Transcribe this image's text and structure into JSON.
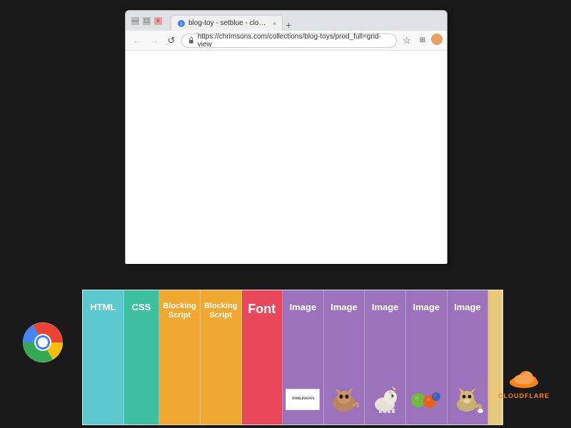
{
  "browser": {
    "tab": {
      "favicon": "ℹ",
      "title": "blog-toy - setblue - cloud...",
      "close": "×"
    },
    "new_tab_label": "+",
    "toolbar": {
      "back": "←",
      "forward": "→",
      "reload": "↺",
      "home": "⌂",
      "address": "https://chrimsons.com/collections/blog-toys/prod_full=grid-view",
      "bookmark": "☆",
      "extensions": "⊞",
      "account": "●"
    },
    "window_controls": {
      "minimize": "—",
      "maximize": "□",
      "close": "×"
    }
  },
  "resources": [
    {
      "id": "html",
      "label": "HTML",
      "color_class": "item-html",
      "has_thumb": false
    },
    {
      "id": "css",
      "label": "CSS",
      "color_class": "item-css",
      "has_thumb": false
    },
    {
      "id": "blocking1",
      "label": "Blocking\nScript",
      "color_class": "item-blocking1",
      "has_thumb": false
    },
    {
      "id": "blocking2",
      "label": "Blocking\nScript",
      "color_class": "item-blocking2",
      "has_thumb": false
    },
    {
      "id": "font",
      "label": "Font",
      "color_class": "item-font",
      "has_thumb": false
    },
    {
      "id": "image1",
      "label": "Image",
      "color_class": "item-image1",
      "has_thumb": true,
      "thumb": "tomlinsons"
    },
    {
      "id": "image2",
      "label": "Image",
      "color_class": "item-image2",
      "has_thumb": true,
      "thumb": "cat"
    },
    {
      "id": "image3",
      "label": "Image",
      "color_class": "item-image3",
      "has_thumb": true,
      "thumb": "horse"
    },
    {
      "id": "image4",
      "label": "Image",
      "color_class": "item-image4",
      "has_thumb": true,
      "thumb": "balls"
    },
    {
      "id": "image5",
      "label": "Image",
      "color_class": "item-image5",
      "has_thumb": true,
      "thumb": "fox"
    }
  ],
  "cloudflare": {
    "text": "CLOUDFLARE"
  },
  "chrome_icon": "chrome"
}
